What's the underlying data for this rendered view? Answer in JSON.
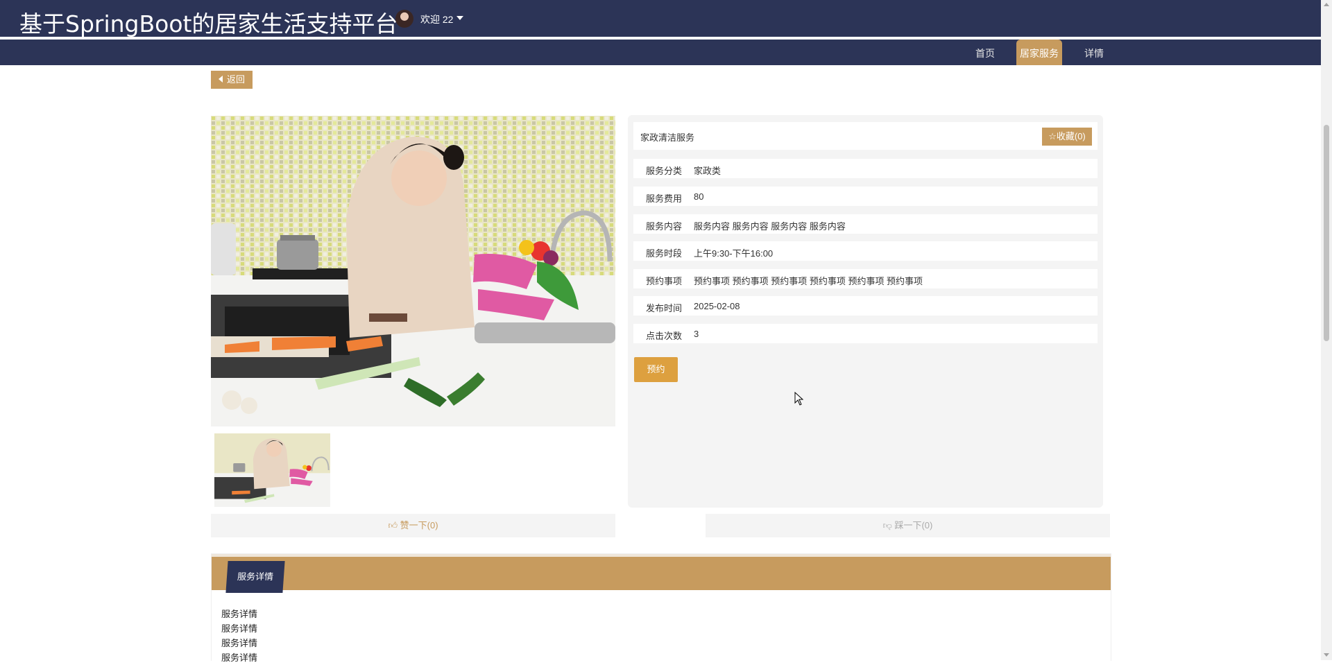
{
  "header": {
    "site_title": "基于SpringBoot的居家生活支持平台",
    "welcome": "欢迎 22"
  },
  "nav": {
    "items": [
      {
        "label": "首页",
        "active": false
      },
      {
        "label": "居家服务",
        "active": true
      },
      {
        "label": "详情",
        "active": false
      }
    ]
  },
  "back_label": "返回",
  "service": {
    "title": "家政清洁服务",
    "favorite_label": "收藏(0)",
    "fields": [
      {
        "label": "服务分类",
        "value": "家政类"
      },
      {
        "label": "服务费用",
        "value": "80"
      },
      {
        "label": "服务内容",
        "value": "服务内容 服务内容 服务内容 服务内容"
      },
      {
        "label": "服务时段",
        "value": "上午9:30-下午16:00"
      },
      {
        "label": "预约事项",
        "value": "预约事项 预约事项 预约事项 预约事项 预约事项 预约事项"
      },
      {
        "label": "发布时间",
        "value": "2025-02-08"
      },
      {
        "label": "点击次数",
        "value": "3"
      }
    ],
    "book_label": "预约"
  },
  "votes": {
    "up_label": "赞一下(0)",
    "down_label": "踩一下(0)"
  },
  "detail": {
    "tab_label": "服务详情",
    "lines": [
      "服务详情",
      "服务详情",
      "服务详情",
      "服务详情"
    ]
  },
  "colors": {
    "navy": "#2c3457",
    "accent": "#c79b5e",
    "book_button": "#dda03f"
  },
  "icons": [
    "chevron-left-icon",
    "star-icon",
    "thumbs-up-icon",
    "thumbs-down-icon",
    "caret-down-icon"
  ]
}
